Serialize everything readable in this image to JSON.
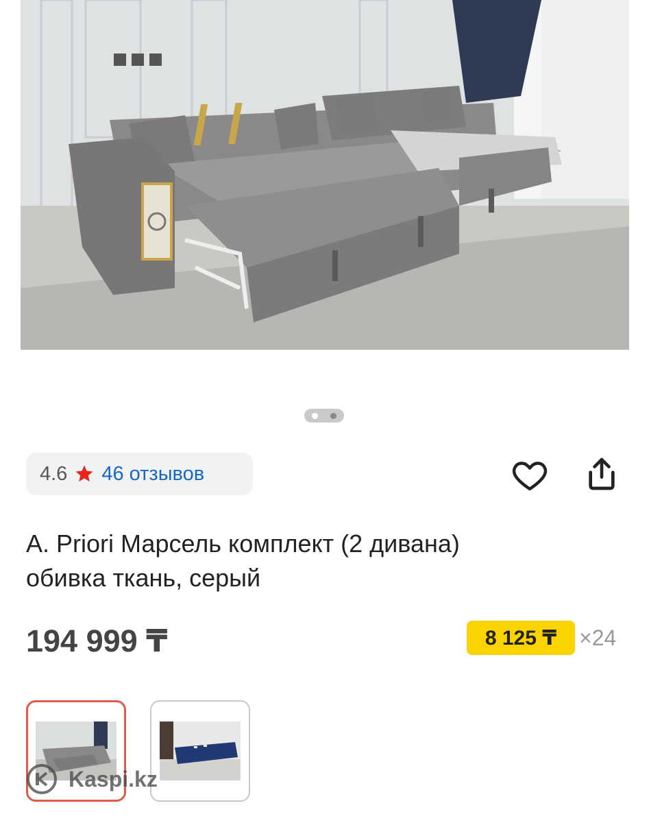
{
  "gallery": {
    "hero_alt": "product-photo-gray-sofa",
    "slide_count": 2,
    "active_slide": 1
  },
  "rating": {
    "value": "4.6",
    "reviews_link": "46 отзывов",
    "star_color": "#e8261c",
    "link_color": "#1668c7"
  },
  "actions": {
    "favorite_icon": "heart-icon",
    "share_icon": "share-icon"
  },
  "product": {
    "title_line1": "A. Priori Марсель комплект (2 дивана)",
    "title_line2": "обивка ткань, серый",
    "price": "194 999 ₸",
    "installment_amount": "8 125 ₸",
    "installment_months": "×24",
    "installment_color": "#fbd400"
  },
  "thumbnails": [
    {
      "name": "thumbnail-gray-sofa",
      "selected": true
    },
    {
      "name": "thumbnail-blue-sofa",
      "selected": false
    }
  ],
  "watermark": {
    "text": "Kaspi.kz"
  }
}
